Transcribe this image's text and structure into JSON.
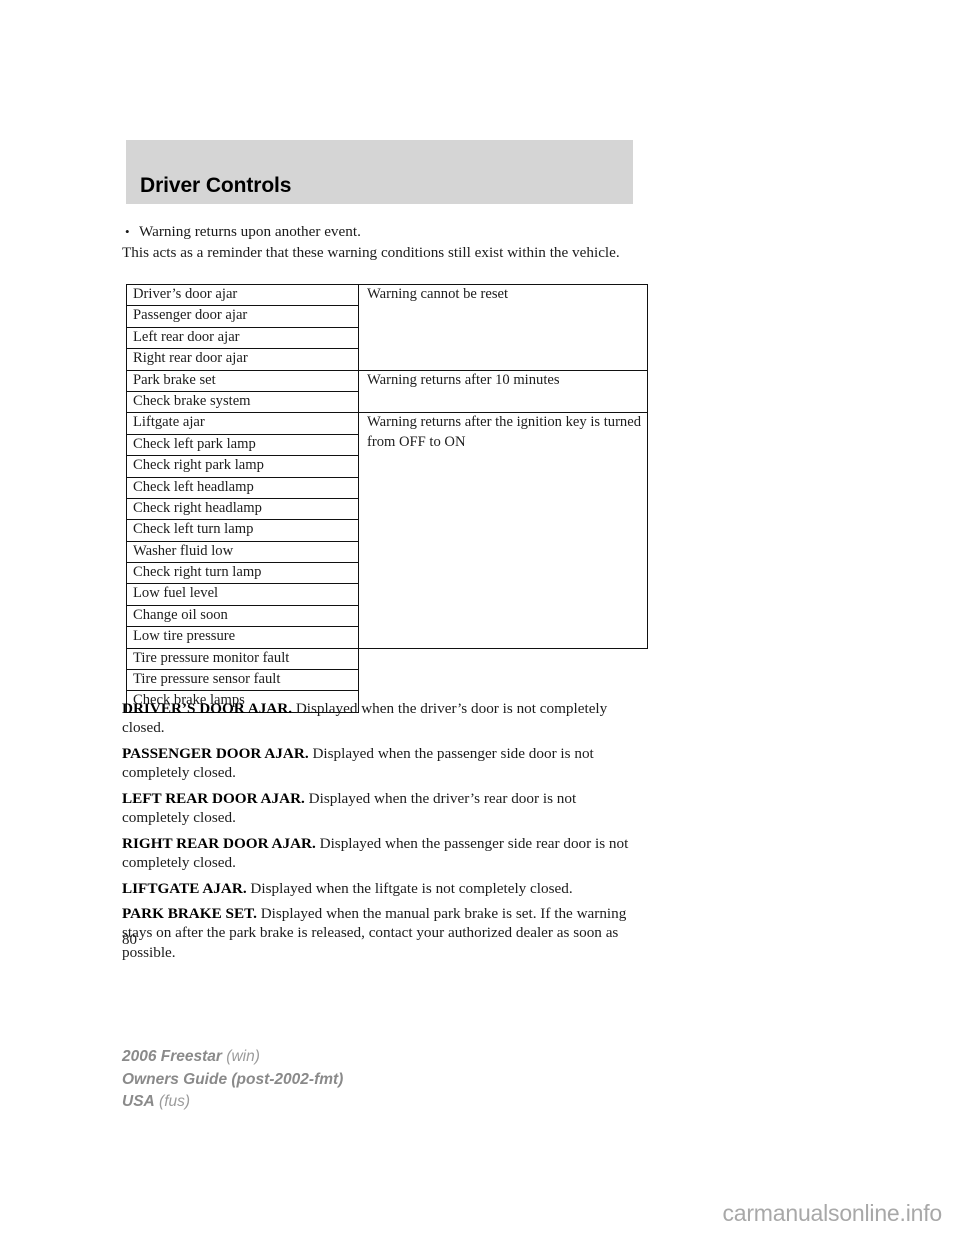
{
  "header": {
    "chapter_title": "Driver Controls",
    "band_color": "#d5d5d5"
  },
  "intro": {
    "bullet_glyph": "•",
    "bullet_text": "Warning returns upon another event.",
    "paragraph": "This acts as a reminder that these warning conditions still exist within the vehicle."
  },
  "table": {
    "rows": [
      {
        "warning": "Driver’s door ajar",
        "reset": "Warning cannot be reset",
        "reset_span": 4
      },
      {
        "warning": "Passenger door ajar",
        "reset": null
      },
      {
        "warning": "Left rear door ajar",
        "reset": null
      },
      {
        "warning": "Right rear door ajar",
        "reset": null
      },
      {
        "warning": "Park brake set",
        "reset": "Warning returns after 10 minutes",
        "reset_span": 2
      },
      {
        "warning": "Check brake system",
        "reset": null
      },
      {
        "warning": "Liftgate ajar",
        "reset": "Warning returns after the ignition key is turned from OFF to ON",
        "reset_span": 11
      },
      {
        "warning": "Check left park lamp",
        "reset": null
      },
      {
        "warning": "Check right park lamp",
        "reset": null
      },
      {
        "warning": "Check left headlamp",
        "reset": null
      },
      {
        "warning": "Check right headlamp",
        "reset": null
      },
      {
        "warning": "Check left turn lamp",
        "reset": null
      },
      {
        "warning": "Washer fluid low",
        "reset": null
      },
      {
        "warning": "Check right turn lamp",
        "reset": null
      },
      {
        "warning": "Low fuel level",
        "reset": null
      },
      {
        "warning": "Change oil soon",
        "reset": null
      },
      {
        "warning": "Low tire pressure",
        "reset": null
      },
      {
        "warning": "Tire pressure monitor fault",
        "reset": null
      },
      {
        "warning": "Tire pressure sensor fault",
        "reset": null
      },
      {
        "warning": "Check brake lamps",
        "reset": null
      }
    ]
  },
  "definitions": [
    {
      "term": "DRIVER’S DOOR AJAR.",
      "text": "Displayed when the driver’s door is not completely closed."
    },
    {
      "term": "PASSENGER DOOR AJAR.",
      "text": "Displayed when the passenger side door is not completely closed."
    },
    {
      "term": "LEFT REAR DOOR AJAR.",
      "text": "Displayed when the driver’s rear door is not completely closed."
    },
    {
      "term": "RIGHT REAR DOOR AJAR.",
      "text": "Displayed when the passenger side rear door is not completely closed."
    },
    {
      "term": "LIFTGATE AJAR.",
      "text": "Displayed when the liftgate is not completely closed."
    },
    {
      "term": "PARK BRAKE SET.",
      "text": "Displayed when the manual park brake is set. If the warning stays on after the park brake is released, contact your authorized dealer as soon as possible."
    }
  ],
  "page_number": "80",
  "footer": {
    "lines": [
      {
        "strong": "2006 Freestar",
        "paren": "(win)"
      },
      {
        "strong": "Owners Guide (post-2002-fmt)",
        "paren": ""
      },
      {
        "strong": "USA",
        "paren": "(fus)"
      }
    ]
  },
  "watermark": "carmanualsonline.info"
}
